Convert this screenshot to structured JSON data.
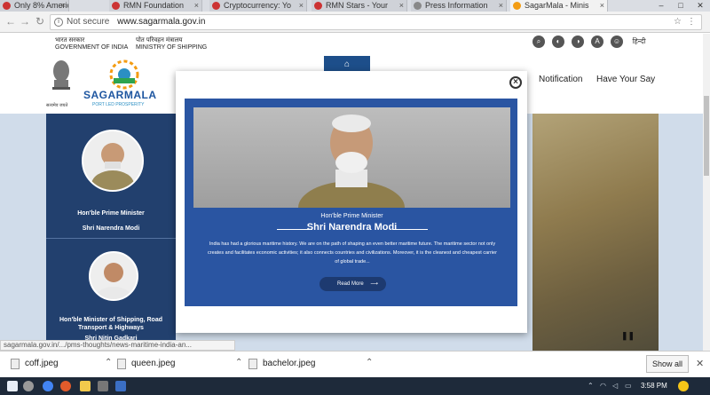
{
  "tabs": [
    {
      "title": "Only 8% America"
    },
    {
      "title": "RMN Foundation"
    },
    {
      "title": "Cryptocurrency: Yo"
    },
    {
      "title": "RMN Stars - Your"
    },
    {
      "title": "Press Information"
    },
    {
      "title": "SagarMala - Minis"
    }
  ],
  "address": {
    "security": "Not secure",
    "url": "www.sagarmala.gov.in"
  },
  "header": {
    "gov_hindi": "भारत सरकार",
    "gov_en": "GOVERNMENT OF INDIA",
    "ministry_hindi": "पोत परिवहन मंत्रालय",
    "ministry_en": "MINISTRY OF SHIPPING",
    "lang": "हिन्दी",
    "logo_text": "SAGARMALA",
    "logo_sub": "PORT LED PROSPERITY",
    "emblem_caption": "सत्यमेव जयते",
    "menu": [
      "Notification",
      "Have Your Say"
    ]
  },
  "left_column": {
    "pm_title": "Hon'ble Prime Minister",
    "pm_name": "Shri Narendra Modi",
    "minister_title": "Hon'ble Minister of Shipping, Road Transport & Highways",
    "minister_name": "Shri Nitin Gadkari"
  },
  "modal": {
    "close": "×",
    "title": "Hon'ble Prime Minister",
    "name": "Shri Narendra Modi",
    "body": "India has had a glorious maritime history. We are on the path of shaping an even better maritime future. The maritime sector not only creates and facilitates economic activities; it also connects countries and civilizations. Moreover, it is the cleanest and cheapest carrier of global trade...",
    "button": "Read More"
  },
  "status_url": "sagarmala.gov.in/.../pms-thoughts/news-maritime-india-an...",
  "downloads": {
    "items": [
      "coff.jpeg",
      "queen.jpeg",
      "bachelor.jpeg"
    ],
    "show_all": "Show all"
  },
  "taskbar": {
    "time": "3:58 PM"
  },
  "colors": {
    "brand_blue": "#2a55a2",
    "navy": "#22406e",
    "logo_blue": "#1e56a0"
  }
}
